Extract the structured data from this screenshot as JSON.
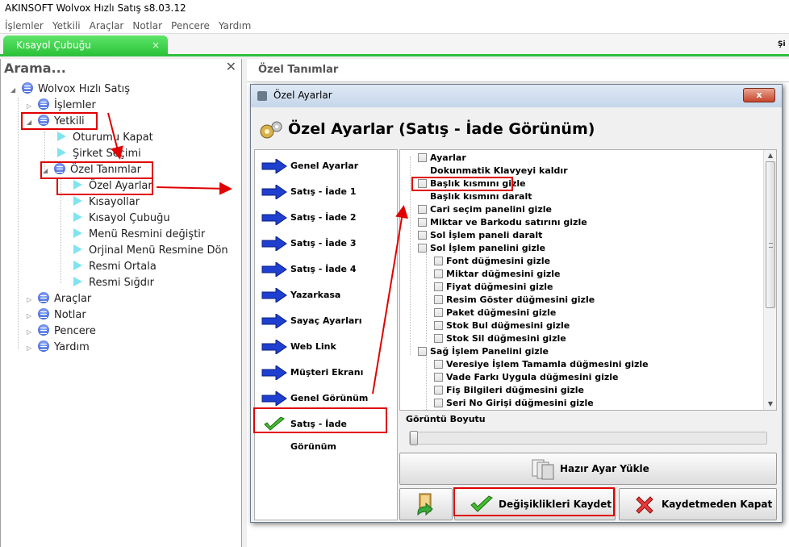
{
  "app": {
    "title": "AKINSOFT Wolvox Hızlı Satış s8.03.12"
  },
  "menubar": [
    "İşlemler",
    "Yetkili",
    "Araçlar",
    "Notlar",
    "Pencere",
    "Yardım"
  ],
  "tabs": {
    "active_label": "Kısayol Çubuğu",
    "close_glyph": "×",
    "right_edge_text": "Şi"
  },
  "search": {
    "title": "Arama...",
    "close_glyph": "✕"
  },
  "tree": {
    "root": "Wolvox Hızlı Satış",
    "islemler": "İşlemler",
    "yetkili": "Yetkili",
    "oturumu_kapat": "Oturumu Kapat",
    "sirket_secimi": "Şirket Seçimi",
    "ozel_tanimlar": "Özel Tanımlar",
    "ozel_ayarlar": "Özel Ayarlar",
    "kisayollar": "Kısayollar",
    "kisayol_cubugu": "Kısayol Çubuğu",
    "menu_resmini_degistir": "Menü Resmini değiştir",
    "orjinal_menu": "Orjinal Menü Resmine Dön",
    "resmi_ortala": "Resmi Ortala",
    "resmi_sigdir": "Resmi Sığdır",
    "araclar": "Araçlar",
    "notlar": "Notlar",
    "pencere": "Pencere",
    "yardim": "Yardım"
  },
  "right_pane": {
    "header": "Özel Tanımlar"
  },
  "dialog": {
    "caption": "Özel Ayarlar",
    "close_glyph": "x",
    "header": "Özel Ayarlar (Satış - İade Görünüm)",
    "nav": [
      "Genel Ayarlar",
      "Satış - İade 1",
      "Satış - İade 2",
      "Satış - İade 3",
      "Satış - İade 4",
      "Yazarkasa",
      "Sayaç Ayarları",
      "Web Link",
      "Müşteri Ekranı",
      "Genel Görünüm",
      "Satış - İade Görünüm"
    ],
    "options": [
      "Ayarlar",
      "Dokunmatik Klavyeyi kaldır",
      "Başlık kısmını gizle",
      "Başlık kısmını daralt",
      "Cari seçim panelini gizle",
      "Miktar ve Barkodu satırını gizle",
      "Sol İşlem paneli daralt",
      "Sol İşlem panelini gizle",
      "Font düğmesini gizle",
      "Miktar düğmesini gizle",
      "Fiyat düğmesini gizle",
      "Resim Göster düğmesini gizle",
      "Paket düğmesini gizle",
      "Stok Bul düğmesini gizle",
      "Stok Sil düğmesini gizle",
      "Sağ İşlem Panelini gizle",
      "Veresiye İşlem Tamamla düğmesini gizle",
      "Vade Farkı Uygula düğmesini gizle",
      "Fiş Bilgileri düğmesini gizle",
      "Seri No Girişi düğmesini gizle"
    ],
    "size_label": "Görüntü Boyutu",
    "buttons": {
      "load_preset": "Hazır Ayar Yükle",
      "save": "Değişiklikleri Kaydet",
      "close_without_save": "Kaydetmeden Kapat"
    }
  },
  "colors": {
    "tab_green": "#2fbf3f",
    "highlight_red": "#e00000",
    "nav_arrow_blue": "#1f3fd0"
  }
}
